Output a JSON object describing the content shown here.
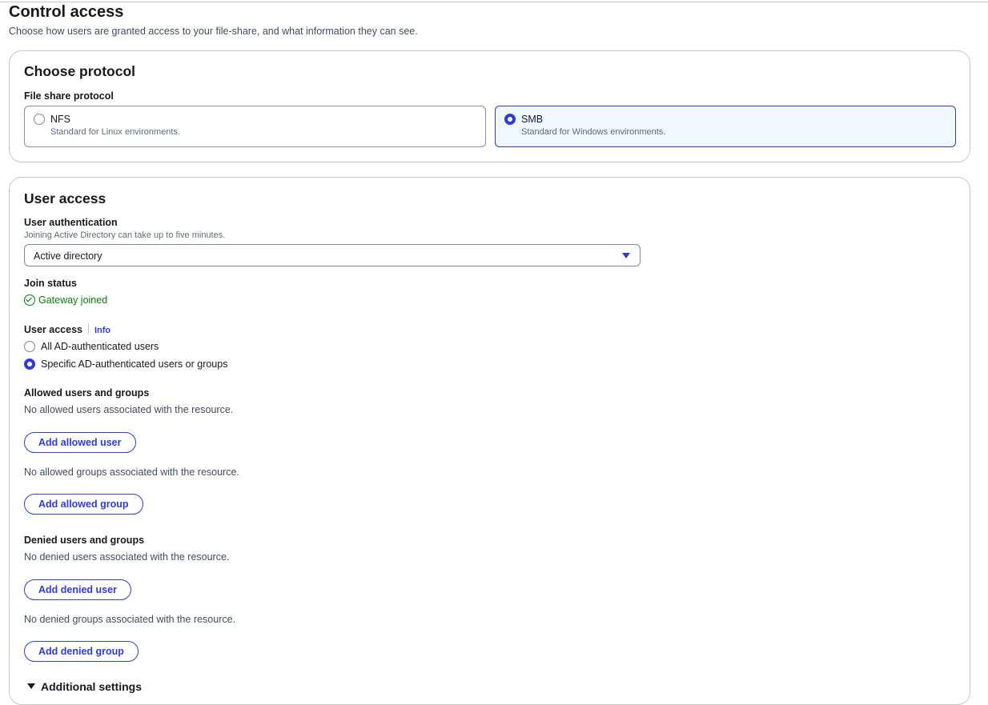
{
  "page": {
    "title": "Control access",
    "description": "Choose how users are granted access to your file-share, and what information they can see."
  },
  "protocol": {
    "heading": "Choose protocol",
    "label": "File share protocol",
    "options": [
      {
        "name": "NFS",
        "description": "Standard for Linux environments.",
        "selected": false
      },
      {
        "name": "SMB",
        "description": "Standard for Windows environments.",
        "selected": true
      }
    ]
  },
  "user_access": {
    "heading": "User access",
    "auth_label": "User authentication",
    "auth_description": "Joining Active Directory can take up to five minutes.",
    "auth_value": "Active directory",
    "join_status_label": "Join status",
    "join_status": "Gateway joined",
    "access_label": "User access",
    "info_link": "Info",
    "access_options": [
      {
        "label": "All AD-authenticated users",
        "selected": false
      },
      {
        "label": "Specific AD-authenticated users or groups",
        "selected": true
      }
    ],
    "allowed_heading": "Allowed users and groups",
    "no_allowed_users": "No allowed users associated with the resource.",
    "add_allowed_user": "Add allowed user",
    "no_allowed_groups": "No allowed groups associated with the resource.",
    "add_allowed_group": "Add allowed group",
    "denied_heading": "Denied users and groups",
    "no_denied_users": "No denied users associated with the resource.",
    "add_denied_user": "Add denied user",
    "no_denied_groups": "No denied groups associated with the resource.",
    "add_denied_group": "Add denied group",
    "additional_settings": "Additional settings"
  },
  "colors": {
    "accent": "#2e3bd6",
    "success": "#037f0c",
    "selected_tile_bg": "#f0f8ff"
  }
}
